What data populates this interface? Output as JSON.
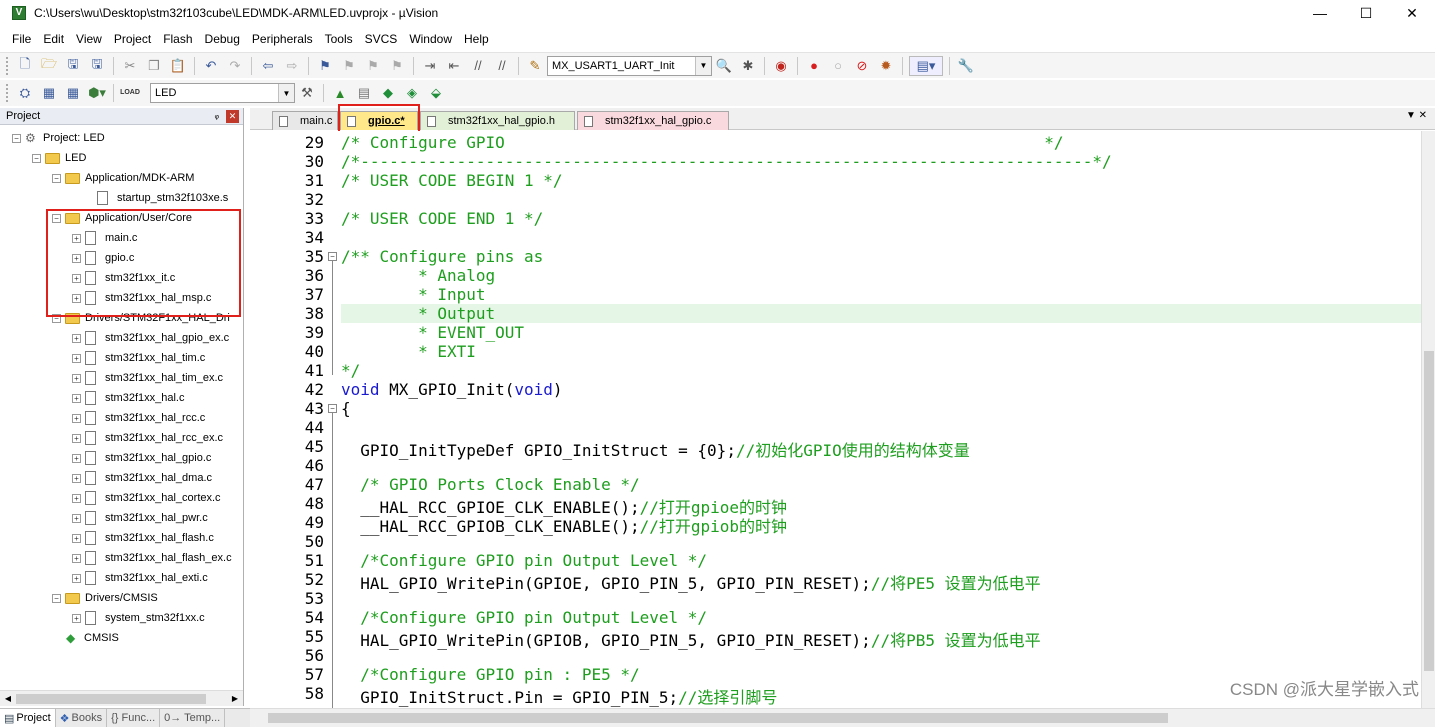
{
  "window": {
    "title": "C:\\Users\\wu\\Desktop\\stm32f103cube\\LED\\MDK-ARM\\LED.uvprojx - µVision",
    "minimize": "—",
    "maximize": "☐",
    "close": "✕"
  },
  "menu": [
    "File",
    "Edit",
    "View",
    "Project",
    "Flash",
    "Debug",
    "Peripherals",
    "Tools",
    "SVCS",
    "Window",
    "Help"
  ],
  "toolbar": {
    "function_combo": "MX_USART1_UART_Init",
    "target_combo": "LED",
    "load_label": "LOAD"
  },
  "project_panel": {
    "title": "Project",
    "pin": "ᵩ",
    "close": "✕",
    "nodes": [
      {
        "label": "Project: LED"
      },
      {
        "label": "LED"
      },
      {
        "label": "Application/MDK-ARM"
      },
      {
        "label": "startup_stm32f103xe.s"
      },
      {
        "label": "Application/User/Core"
      },
      {
        "label": "main.c"
      },
      {
        "label": "gpio.c"
      },
      {
        "label": "stm32f1xx_it.c"
      },
      {
        "label": "stm32f1xx_hal_msp.c"
      },
      {
        "label": "Drivers/STM32F1xx_HAL_Dri"
      },
      {
        "label": "stm32f1xx_hal_gpio_ex.c"
      },
      {
        "label": "stm32f1xx_hal_tim.c"
      },
      {
        "label": "stm32f1xx_hal_tim_ex.c"
      },
      {
        "label": "stm32f1xx_hal.c"
      },
      {
        "label": "stm32f1xx_hal_rcc.c"
      },
      {
        "label": "stm32f1xx_hal_rcc_ex.c"
      },
      {
        "label": "stm32f1xx_hal_gpio.c"
      },
      {
        "label": "stm32f1xx_hal_dma.c"
      },
      {
        "label": "stm32f1xx_hal_cortex.c"
      },
      {
        "label": "stm32f1xx_hal_pwr.c"
      },
      {
        "label": "stm32f1xx_hal_flash.c"
      },
      {
        "label": "stm32f1xx_hal_flash_ex.c"
      },
      {
        "label": "stm32f1xx_hal_exti.c"
      },
      {
        "label": "Drivers/CMSIS"
      },
      {
        "label": "system_stm32f1xx.c"
      },
      {
        "label": "CMSIS"
      }
    ]
  },
  "bottom_tabs": [
    "Project",
    "Books",
    "{} Func...",
    "0→ Temp..."
  ],
  "editor_tabs": [
    {
      "label": "main.c"
    },
    {
      "label": "gpio.c*"
    },
    {
      "label": "stm32f1xx_hal_gpio.h"
    },
    {
      "label": "stm32f1xx_hal_gpio.c"
    }
  ],
  "tab_overflow": "▼ ✕",
  "code_lines": [
    {
      "n": "29",
      "text": "/* Configure GPIO                                                        */"
    },
    {
      "n": "30",
      "text": "/*----------------------------------------------------------------------------*/"
    },
    {
      "n": "31",
      "text": "/* USER CODE BEGIN 1 */"
    },
    {
      "n": "32",
      "text": ""
    },
    {
      "n": "33",
      "text": "/* USER CODE END 1 */"
    },
    {
      "n": "34",
      "text": ""
    },
    {
      "n": "35",
      "text": "/** Configure pins as"
    },
    {
      "n": "36",
      "text": "        * Analog"
    },
    {
      "n": "37",
      "text": "        * Input"
    },
    {
      "n": "38",
      "text": "        * Output"
    },
    {
      "n": "39",
      "text": "        * EVENT_OUT"
    },
    {
      "n": "40",
      "text": "        * EXTI"
    },
    {
      "n": "41",
      "text": "*/"
    },
    {
      "n": "42",
      "kw1": "void",
      "mid": " MX_GPIO_Init(",
      "kw2": "void",
      "end": ")"
    },
    {
      "n": "43",
      "text": "{"
    },
    {
      "n": "44",
      "text": ""
    },
    {
      "n": "45",
      "code": "  GPIO_InitTypeDef GPIO_InitStruct = {0};",
      "comment": "//初始化GPIO使用的结构体变量"
    },
    {
      "n": "46",
      "text": ""
    },
    {
      "n": "47",
      "text": "  /* GPIO Ports Clock Enable */"
    },
    {
      "n": "48",
      "code": "  __HAL_RCC_GPIOE_CLK_ENABLE();",
      "comment": "//打开gpioe的时钟"
    },
    {
      "n": "49",
      "code": "  __HAL_RCC_GPIOB_CLK_ENABLE();",
      "comment": "//打开gpiob的时钟"
    },
    {
      "n": "50",
      "text": ""
    },
    {
      "n": "51",
      "text": "  /*Configure GPIO pin Output Level */"
    },
    {
      "n": "52",
      "code": "  HAL_GPIO_WritePin(GPIOE, GPIO_PIN_5, GPIO_PIN_RESET);",
      "comment": "//将PE5 设置为低电平"
    },
    {
      "n": "53",
      "text": ""
    },
    {
      "n": "54",
      "text": "  /*Configure GPIO pin Output Level */"
    },
    {
      "n": "55",
      "code": "  HAL_GPIO_WritePin(GPIOB, GPIO_PIN_5, GPIO_PIN_RESET);",
      "comment": "//将PB5 设置为低电平"
    },
    {
      "n": "56",
      "text": ""
    },
    {
      "n": "57",
      "text": "  /*Configure GPIO pin : PE5 */"
    },
    {
      "n": "58",
      "code": "  GPIO_InitStruct.Pin = GPIO_PIN_5;",
      "comment": "//选择引脚号"
    }
  ],
  "watermark": "CSDN @派大星学嵌入式",
  "colors": {
    "comment": "#1e9e1e",
    "keyword": "#1a1ad0",
    "highlight_line": "#e6f6e6",
    "annotation_box": "#e0201a",
    "active_tab": "#ffe88a",
    "header_tab": "#e3f0d8",
    "source_tab": "#f9d9dd"
  }
}
